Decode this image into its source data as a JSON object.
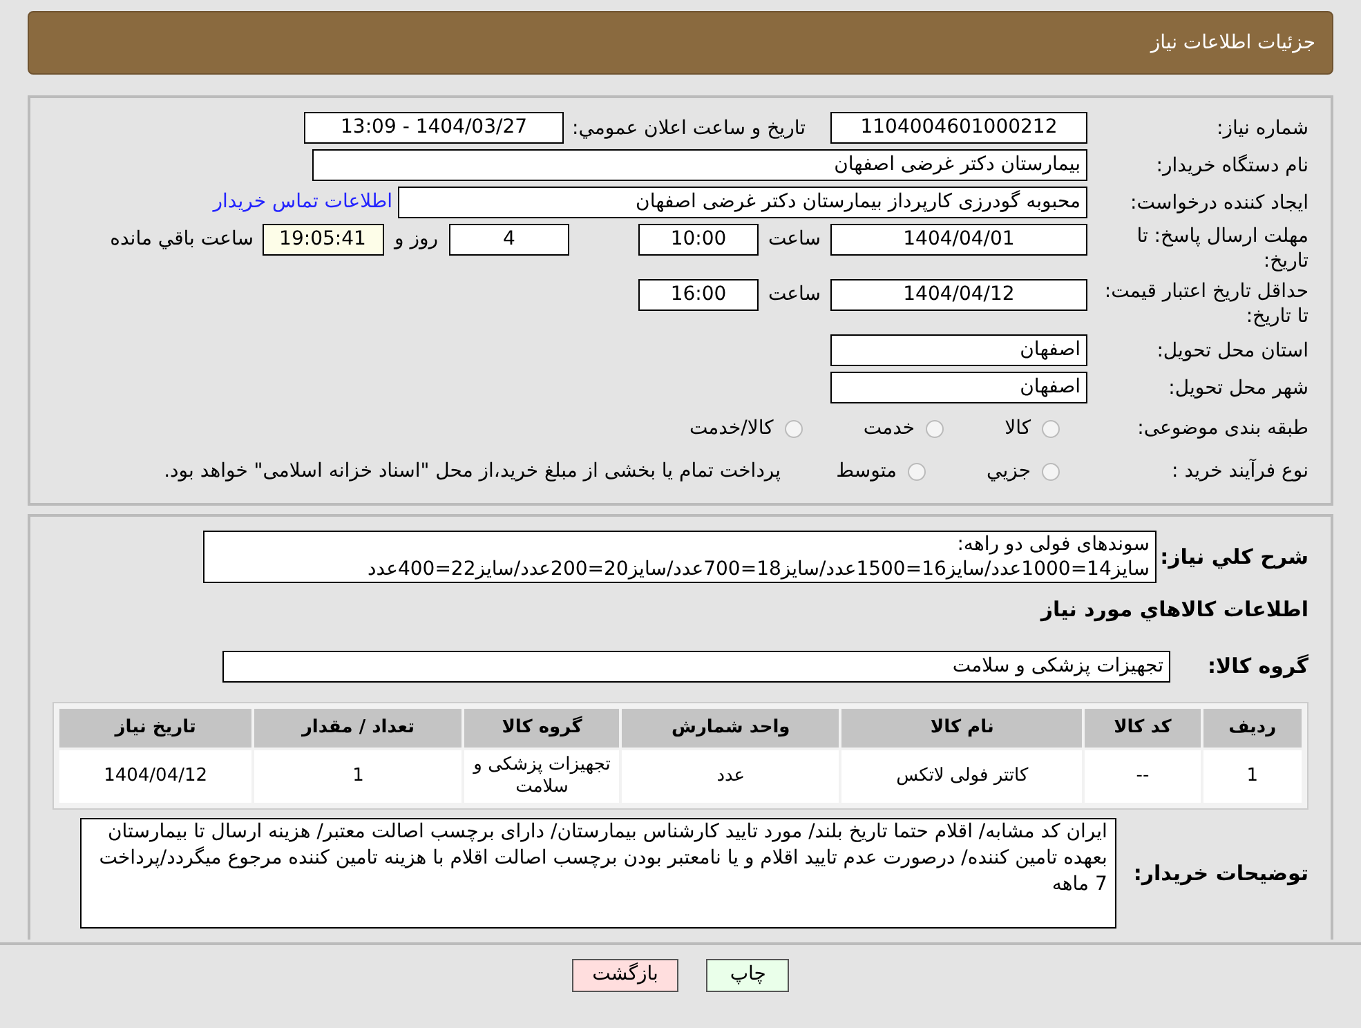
{
  "header": {
    "title": "جزئیات اطلاعات نیاز"
  },
  "form": {
    "need_number": {
      "label": "شماره نیاز:",
      "value": "1104004601000212"
    },
    "announce": {
      "label": "تاريخ و ساعت اعلان عمومي:",
      "value": "1404/03/27 - 13:09"
    },
    "buyer_org": {
      "label": "نام دستگاه خريدار:",
      "value": "بيمارستان دکتر غرضی اصفهان"
    },
    "creator": {
      "label": "ايجاد کننده درخواست:",
      "value": "محبوبه گودرزی کارپرداز بیمارستان دکتر غرضی اصفهان",
      "link": "اطلاعات تماس خريدار"
    },
    "response_deadline": {
      "label": "مهلت ارسال پاسخ: تا تاریخ:",
      "date": "1404/04/01",
      "time_label": "ساعت",
      "time": "10:00",
      "days": "4",
      "days_suffix": "روز و",
      "remaining": "19:05:41",
      "remaining_suffix": "ساعت باقي مانده"
    },
    "price_validity": {
      "label": "حداقل تاريخ اعتبار قيمت: تا تاریخ:",
      "date": "1404/04/12",
      "time_label": "ساعت",
      "time": "16:00"
    },
    "province": {
      "label": "استان محل تحويل:",
      "value": "اصفهان"
    },
    "city": {
      "label": "شهر محل تحويل:",
      "value": "اصفهان"
    },
    "category": {
      "label": "طبقه بندی موضوعی:",
      "options": [
        {
          "label": "کالا",
          "selected": false
        },
        {
          "label": "خدمت",
          "selected": false
        },
        {
          "label": "کالا/خدمت",
          "selected": false
        }
      ]
    },
    "purchase_type": {
      "label": "نوع فرآيند خريد :",
      "options": [
        {
          "label": "جزيي",
          "selected": false
        },
        {
          "label": "متوسط",
          "selected": false
        }
      ],
      "note": "پرداخت تمام يا بخشی از مبلغ خريد،از محل \"اسناد خزانه اسلامی\" خواهد بود."
    }
  },
  "description": {
    "label": "شرح کلي نياز:",
    "value": "سوندهای فولی دو راهه:\nسایز14=1000عدد/سایز16=1500عدد/سایز18=700عدد/سایز20=200عدد/سایز22=400عدد"
  },
  "goods": {
    "title": "اطلاعات کالاهاي مورد نياز",
    "group": {
      "label": "گروه کالا:",
      "value": "تجهیزات پزشکی و سلامت"
    },
    "table": {
      "columns": [
        "رديف",
        "کد کالا",
        "نام کالا",
        "واحد شمارش",
        "گروه کالا",
        "تعداد / مقدار",
        "تاريخ نياز"
      ],
      "rows": [
        [
          "1",
          "--",
          "کاتتر فولی لاتکس",
          "عدد",
          "تجهیزات پزشکی و سلامت",
          "1",
          "1404/04/12"
        ]
      ]
    },
    "notes": {
      "label": "توضيحات خريدار:",
      "value": "ایران کد مشابه/ اقلام حتما تاریخ بلند/ مورد تایید کارشناس بیمارستان/ دارای برچسب اصالت معتبر/ هزینه ارسال تا بیمارستان بعهده تامین کننده/ درصورت عدم تایید اقلام و یا نامعتبر بودن برچسب اصالت اقلام با هزینه تامین کننده مرجوع میگردد/پرداخت 7 ماهه"
    }
  },
  "buttons": [
    {
      "label": "چاپ",
      "kind": "print"
    },
    {
      "label": "بازگشت",
      "kind": "back"
    }
  ]
}
